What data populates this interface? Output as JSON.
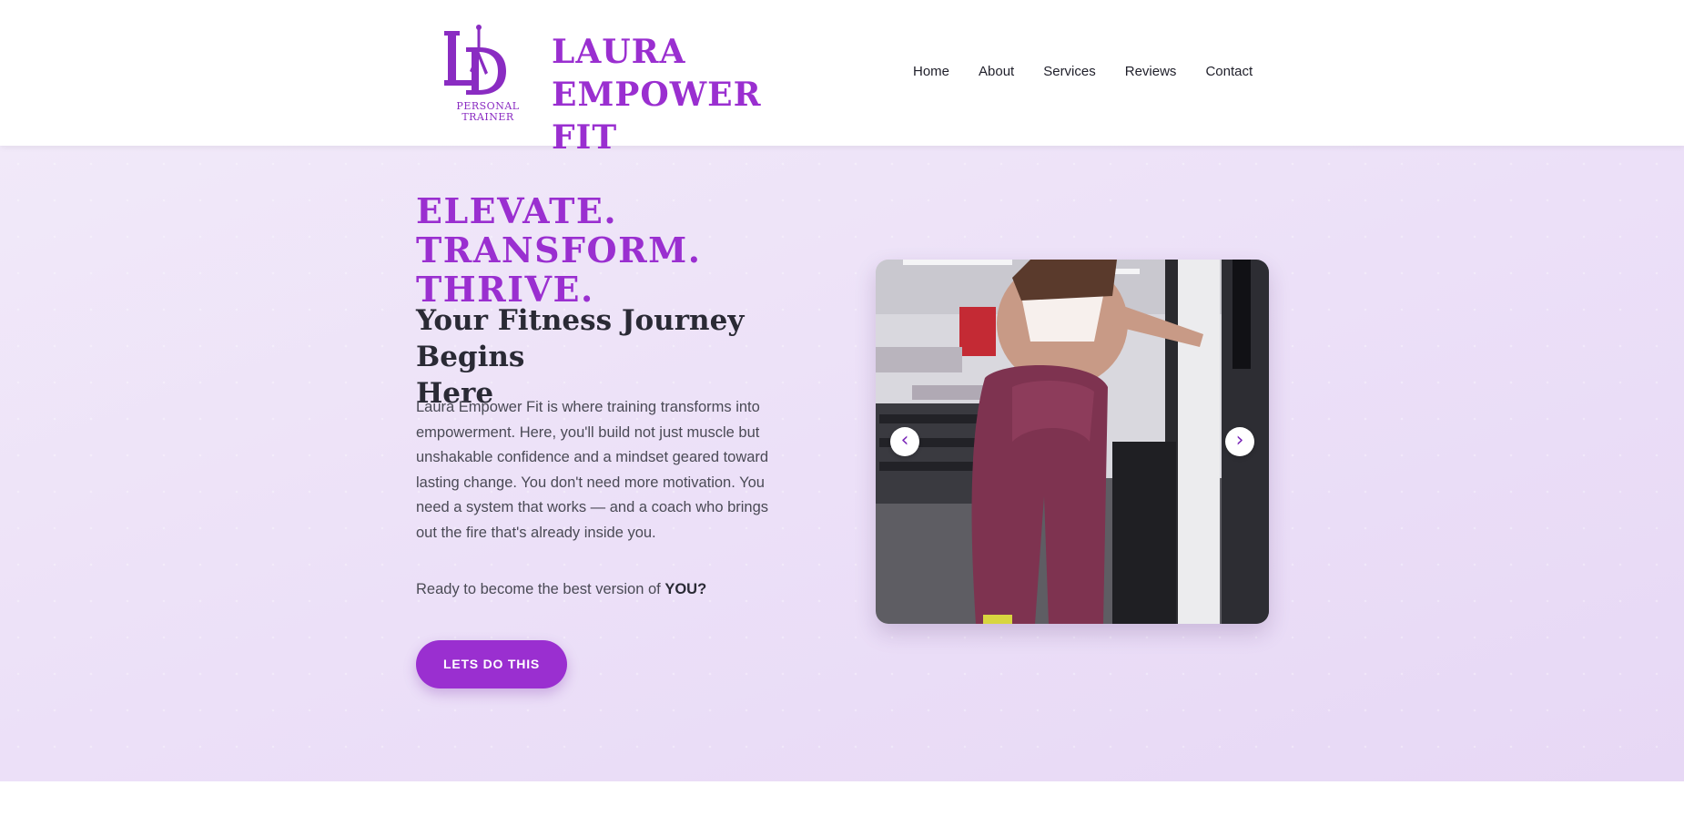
{
  "header": {
    "logo_monogram": "LD",
    "logo_caption_line1": "PERSONAL",
    "logo_caption_line2": "TRAINER",
    "brand_line1": "LAURA EMPOWER",
    "brand_line2": "FIT",
    "nav": [
      "Home",
      "About",
      "Services",
      "Reviews",
      "Contact"
    ]
  },
  "hero": {
    "tagline_line1": "ELEVATE.",
    "tagline_line2": "TRANSFORM. THRIVE.",
    "heading_line1": "Your Fitness Journey Begins",
    "heading_line2": "Here",
    "intro": [
      "Laura Empower Fit is where training transforms into",
      "empowerment. Here, you'll build not just muscle but",
      "unshakable confidence and a mindset geared toward",
      "lasting change. You don't need more motivation. You",
      "need a system that works — and a coach who brings",
      "out the fire that's already inside you."
    ],
    "ready_text": "Ready to become the best version of ",
    "ready_emphasis": "YOU?",
    "cta_label": "LETS DO THIS"
  },
  "carousel": {
    "prev_glyph": "‹",
    "next_glyph": "›"
  },
  "colors": {
    "brand_purple": "#9a2fd0",
    "hero_bg": "#ece0f8",
    "text_dark": "#2a2a35"
  }
}
